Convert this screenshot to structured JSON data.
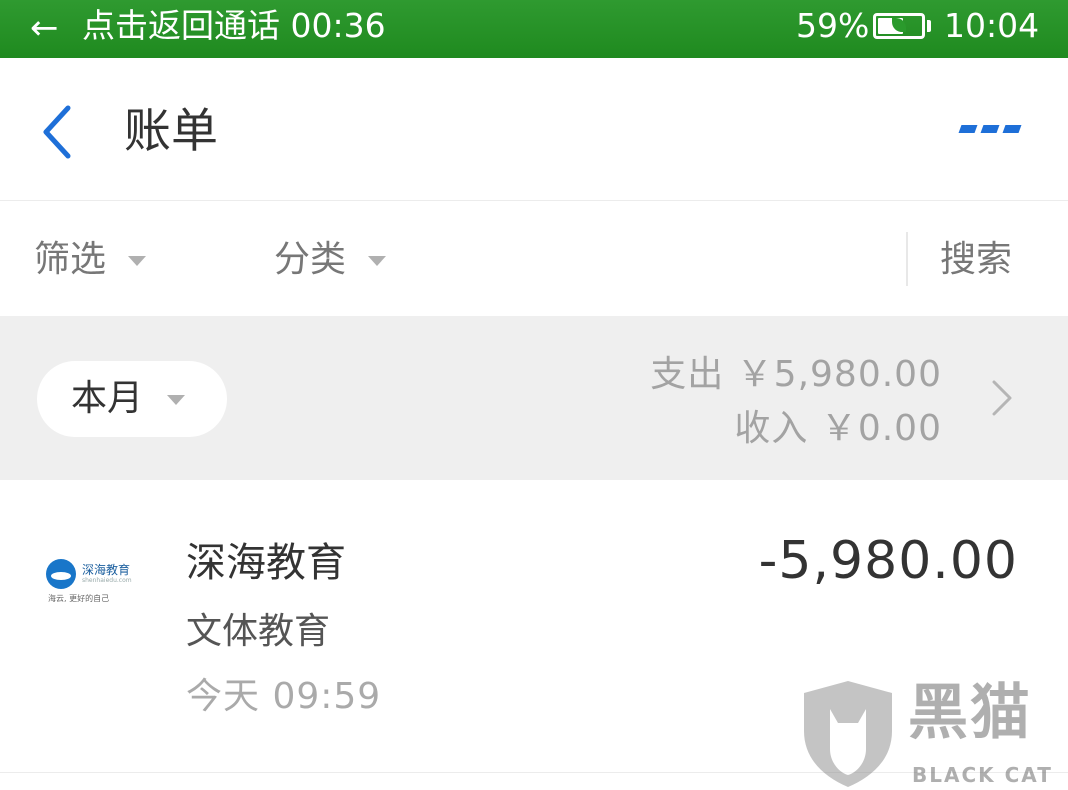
{
  "status_bar": {
    "back_arrow": "←",
    "call_text": "点击返回通话 00:36",
    "battery_percent": "59%",
    "battery_level": 0.59,
    "time": "10:04",
    "icons": [
      "arrow-left-icon",
      "battery-icon"
    ]
  },
  "header": {
    "title": "账单",
    "icons": [
      "chevron-left-icon",
      "more-icon"
    ],
    "accent_color": "#1e6fd8"
  },
  "filters": {
    "filter_label": "筛选",
    "category_label": "分类",
    "search_label": "搜索"
  },
  "month_summary": {
    "month_label": "本月",
    "expense": "支出 ￥5,980.00",
    "income": "收入 ￥0.00"
  },
  "transactions": [
    {
      "merchant": "深海教育",
      "category": "文体教育",
      "time": "今天  09:59",
      "amount": "-5,980.00",
      "logo": {
        "name": "深海教育",
        "sub": "shenhaiedu.com",
        "tagline": "海云, 更好的自己"
      }
    }
  ],
  "watermark": {
    "cn": "黑猫",
    "en": "BLACK CAT"
  },
  "colors": {
    "status_bar": "#2a9a2c",
    "page_bg": "#ffffff",
    "summary_bg": "#efefef"
  }
}
